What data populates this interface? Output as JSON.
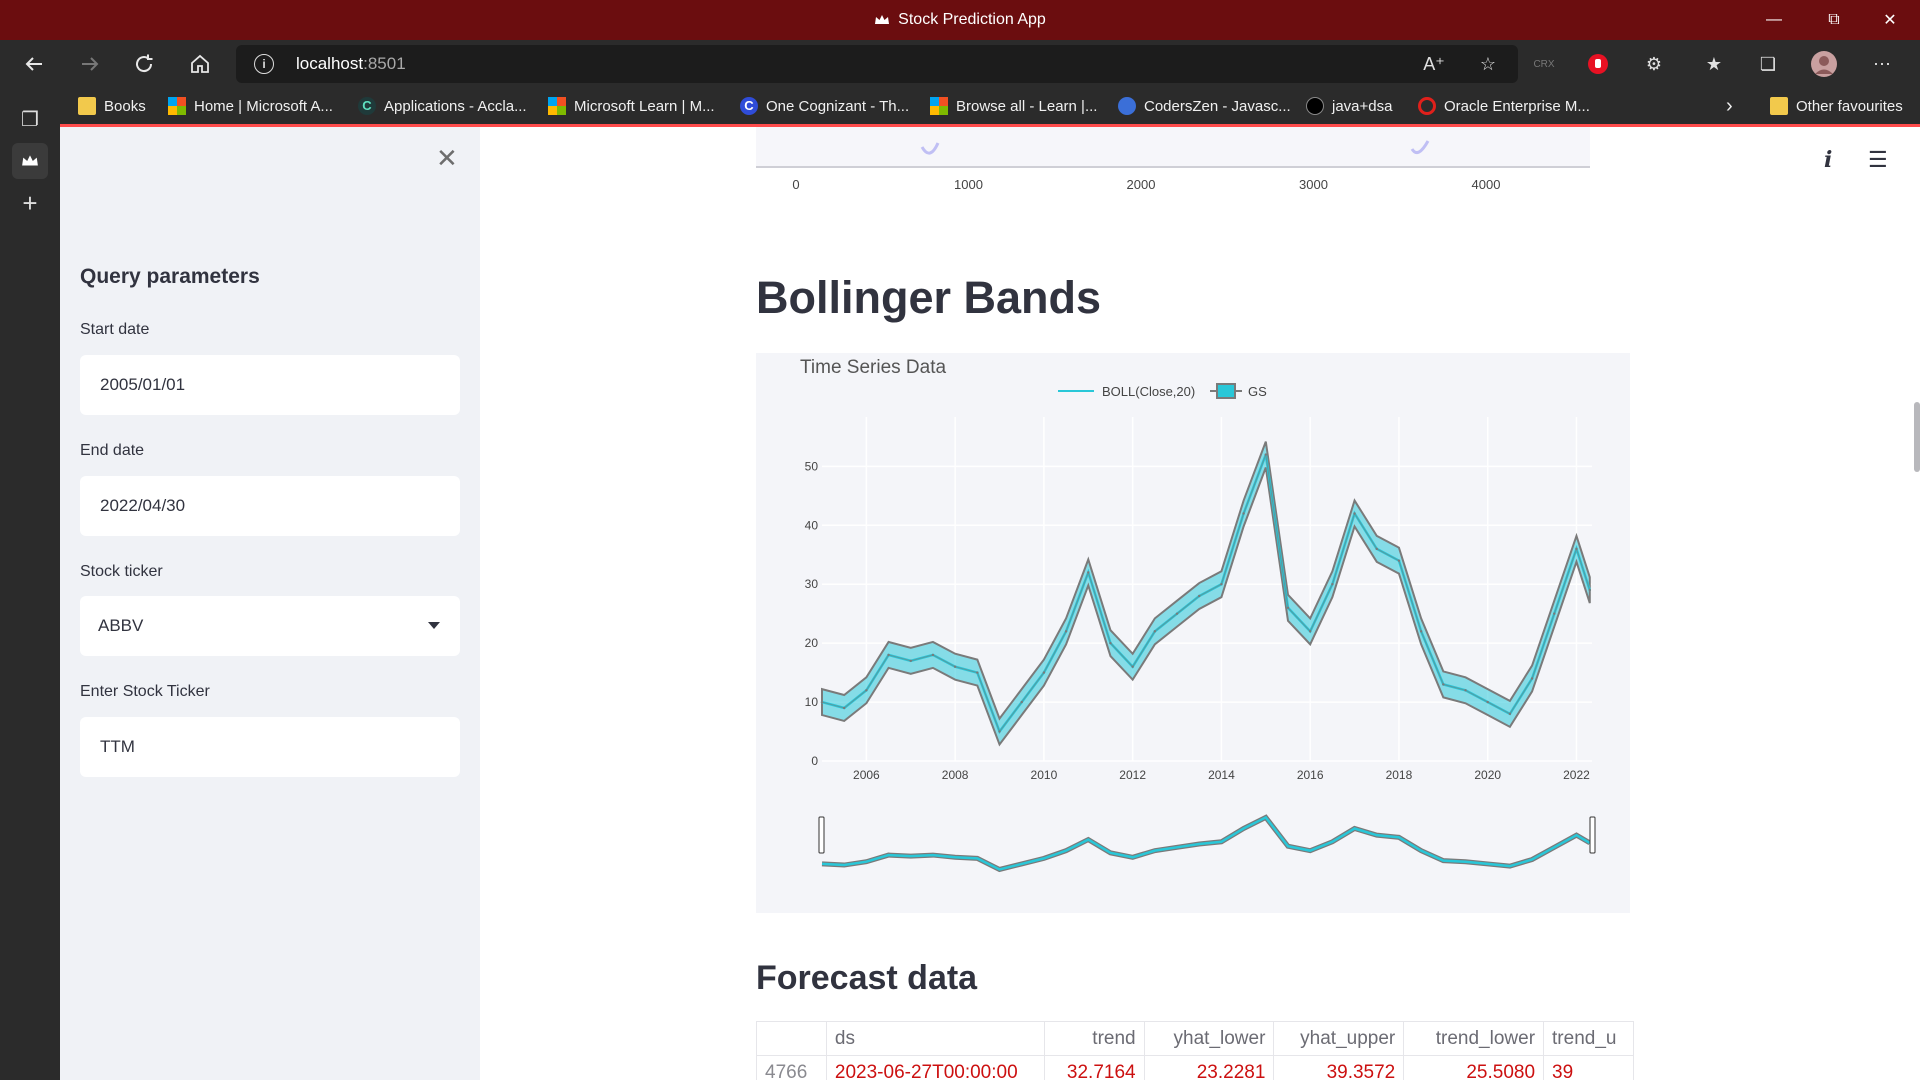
{
  "window": {
    "title": "Stock Prediction App"
  },
  "browser": {
    "url_host": "localhost",
    "url_port": ":8501",
    "bookmarks": [
      {
        "label": "Books",
        "icon": "folder-icon"
      },
      {
        "label": "Home | Microsoft A...",
        "icon": "microsoft-icon"
      },
      {
        "label": "Applications - Accla...",
        "icon": "c-icon"
      },
      {
        "label": "Microsoft Learn | M...",
        "icon": "microsoft-icon"
      },
      {
        "label": "One Cognizant - Th...",
        "icon": "c-icon"
      },
      {
        "label": "Browse all - Learn |...",
        "icon": "microsoft-icon"
      },
      {
        "label": "CodersZen - Javasc...",
        "icon": "coderszen-icon"
      },
      {
        "label": "java+dsa",
        "icon": "triangle-icon"
      },
      {
        "label": "Oracle Enterprise M...",
        "icon": "oracle-icon"
      }
    ],
    "other_favourites": "Other favourites"
  },
  "sidebar": {
    "heading": "Query parameters",
    "start_label": "Start date",
    "start_value": "2005/01/01",
    "end_label": "End date",
    "end_value": "2022/04/30",
    "ticker_label": "Stock ticker",
    "ticker_value": "ABBV",
    "enter_label": "Enter Stock Ticker",
    "enter_value": "TTM"
  },
  "top_axis": {
    "ticks": [
      "0",
      "1000",
      "2000",
      "3000",
      "4000"
    ]
  },
  "bollinger": {
    "section_title": "Bollinger Bands",
    "chart_data": {
      "type": "line",
      "title": "Time Series Data",
      "legend": [
        "BOLL(Close,20)",
        "GS"
      ],
      "legend_position": "top-center",
      "grid": true,
      "x": [
        2005.0,
        2005.5,
        2006.0,
        2006.5,
        2007.0,
        2007.5,
        2008.0,
        2008.5,
        2009.0,
        2009.5,
        2010.0,
        2010.5,
        2011.0,
        2011.5,
        2012.0,
        2012.5,
        2013.0,
        2013.5,
        2014.0,
        2014.5,
        2015.0,
        2015.5,
        2016.0,
        2016.5,
        2017.0,
        2017.5,
        2018.0,
        2018.5,
        2019.0,
        2019.5,
        2020.0,
        2020.5,
        2021.0,
        2021.5,
        2022.0,
        2022.3
      ],
      "xticks": [
        "2006",
        "2008",
        "2010",
        "2012",
        "2014",
        "2016",
        "2018",
        "2020",
        "2022"
      ],
      "xlim": [
        2005.0,
        2022.35
      ],
      "yticks": [
        "0",
        "10",
        "20",
        "30",
        "40",
        "50"
      ],
      "ylim": [
        0,
        56
      ],
      "series": [
        {
          "name": "BOLL(Close,20)",
          "values": [
            10,
            9,
            12,
            18,
            17,
            18,
            16,
            15,
            5,
            10,
            15,
            22,
            32,
            20,
            16,
            22,
            25,
            28,
            30,
            42,
            52,
            26,
            22,
            30,
            42,
            36,
            34,
            22,
            13,
            12,
            10,
            8,
            14,
            25,
            36,
            29
          ]
        },
        {
          "name": "GS",
          "values": [
            10,
            9,
            12,
            18,
            17,
            18,
            16,
            15,
            5,
            10,
            15,
            22,
            32,
            20,
            16,
            22,
            25,
            28,
            30,
            42,
            52,
            26,
            22,
            30,
            42,
            36,
            34,
            22,
            13,
            12,
            10,
            8,
            14,
            25,
            36,
            29
          ]
        }
      ],
      "band_width": 2.2,
      "colors": {
        "boll": "#29c7d8",
        "band": "#7a7a7a"
      },
      "range_selector": true
    }
  },
  "forecast": {
    "title": "Forecast data",
    "columns": [
      "",
      "ds",
      "trend",
      "yhat_lower",
      "yhat_upper",
      "trend_lower",
      "trend_u"
    ],
    "rows": [
      [
        "4766",
        "2023-06-27T00:00:00",
        "32.7164",
        "23.2281",
        "39.3572",
        "25.5080",
        "39"
      ]
    ]
  }
}
